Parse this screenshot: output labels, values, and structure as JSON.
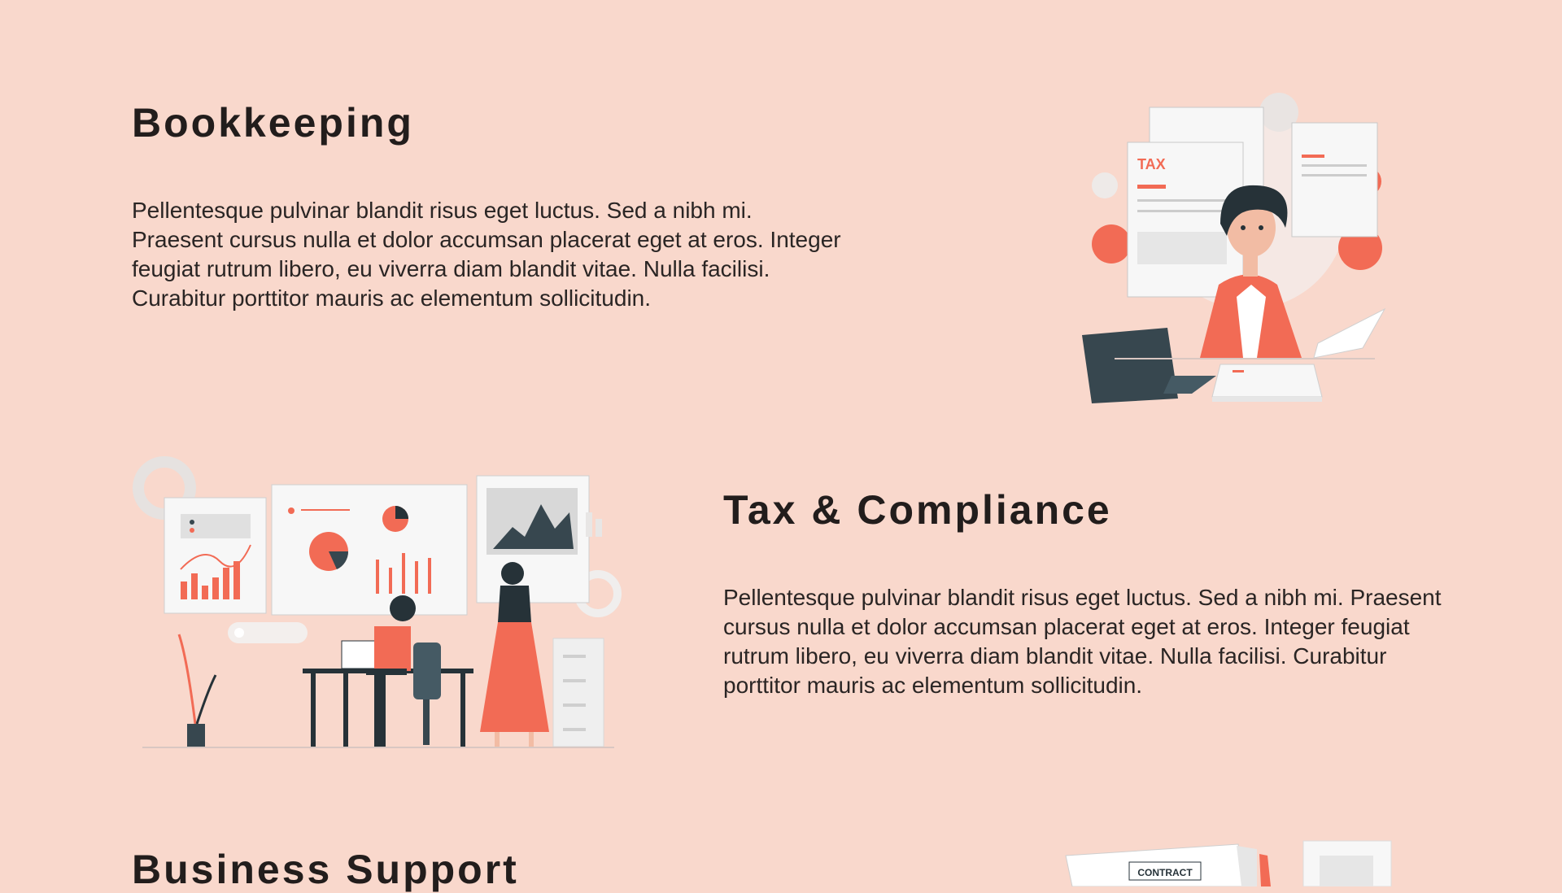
{
  "sections": [
    {
      "title": "Bookkeeping",
      "text": "Pellentesque pulvinar blandit risus eget luctus. Sed a nibh mi. Praesent cursus nulla et dolor accumsan placerat eget at eros. Integer feugiat rutrum libero, eu viverra diam blandit vitae. Nulla facilisi. Curabitur porttitor mauris ac elementum sollicitudin.",
      "illustration_label": "TAX"
    },
    {
      "title": "Tax & Compliance",
      "text": "Pellentesque pulvinar blandit risus eget luctus. Sed a nibh mi. Praesent cursus nulla et dolor accumsan placerat eget at eros. Integer feugiat rutrum libero, eu viverra diam blandit vitae. Nulla facilisi. Curabitur porttitor mauris ac elementum sollicitudin."
    },
    {
      "title": "Business Support",
      "illustration_label": "CONTRACT"
    }
  ],
  "colors": {
    "background": "#f9d8cc",
    "accent": "#f26b55",
    "dark": "#37474f",
    "paper": "#f5f5f5"
  }
}
